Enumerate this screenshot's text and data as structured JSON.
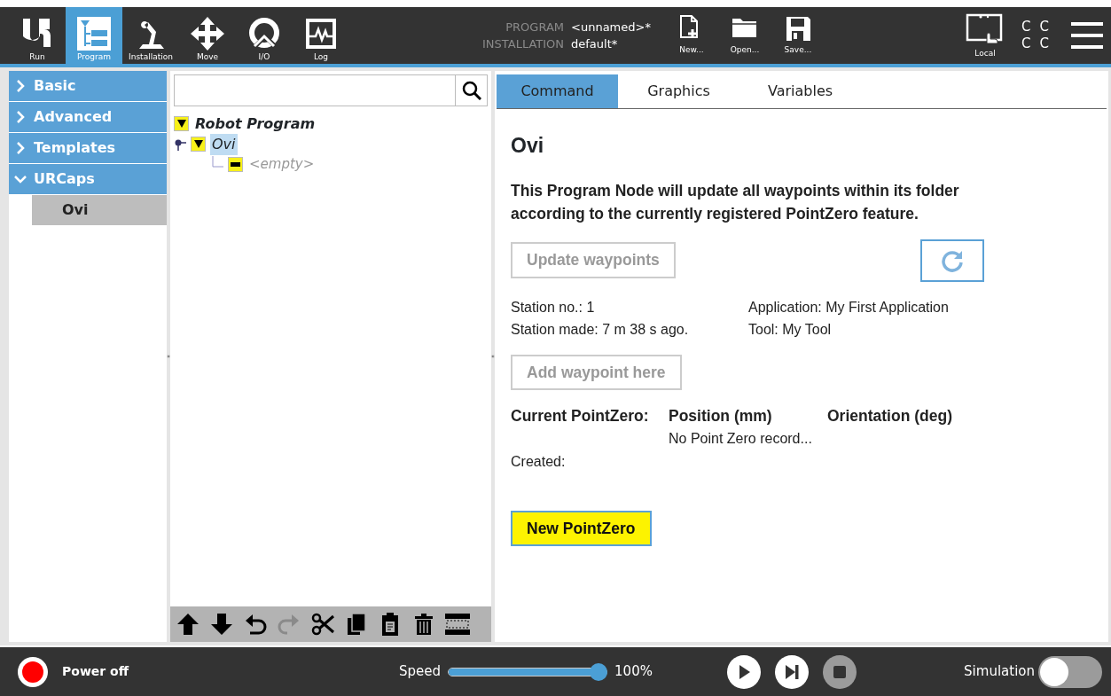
{
  "header": {
    "nav": [
      {
        "label": "Run",
        "kind": "logo",
        "selected": false
      },
      {
        "label": "Program",
        "kind": "program",
        "selected": true
      },
      {
        "label": "Installation",
        "kind": "arm",
        "selected": false
      },
      {
        "label": "Move",
        "kind": "move",
        "selected": false
      },
      {
        "label": "I/O",
        "kind": "io",
        "selected": false
      },
      {
        "label": "Log",
        "kind": "log",
        "selected": false
      }
    ],
    "program_label": "PROGRAM",
    "program_value": "<unnamed>*",
    "installation_label": "INSTALLATION",
    "installation_value": "default*",
    "file_buttons": [
      {
        "label": "New...",
        "kind": "new"
      },
      {
        "label": "Open...",
        "kind": "open"
      },
      {
        "label": "Save...",
        "kind": "save"
      }
    ],
    "mode": "Local",
    "status_letters": [
      "C",
      "C",
      "C",
      "C"
    ]
  },
  "sidebar": [
    {
      "label": "Basic",
      "expanded": false
    },
    {
      "label": "Advanced",
      "expanded": false
    },
    {
      "label": "Templates",
      "expanded": false
    },
    {
      "label": "URCaps",
      "expanded": true,
      "children": [
        {
          "label": "Ovi",
          "selected": true
        }
      ]
    }
  ],
  "tree": [
    {
      "label": "Robot Program",
      "kind": "root",
      "expanded": true,
      "selected": false,
      "children": [
        {
          "label": "Ovi",
          "kind": "node",
          "expanded": true,
          "selected": true,
          "children": [
            {
              "label": "<empty>",
              "kind": "empty"
            }
          ]
        }
      ]
    }
  ],
  "tree_toolbar": [
    {
      "kind": "up",
      "disabled": false
    },
    {
      "kind": "down",
      "disabled": false
    },
    {
      "kind": "undo",
      "disabled": false
    },
    {
      "kind": "redo",
      "disabled": true
    },
    {
      "kind": "cut",
      "disabled": false
    },
    {
      "kind": "copy",
      "disabled": false
    },
    {
      "kind": "paste",
      "disabled": false
    },
    {
      "kind": "delete",
      "disabled": false
    },
    {
      "kind": "suppress",
      "disabled": false
    }
  ],
  "tabs": [
    {
      "label": "Command",
      "selected": true
    },
    {
      "label": "Graphics",
      "selected": false
    },
    {
      "label": "Variables",
      "selected": false
    }
  ],
  "node": {
    "title": "Ovi",
    "description": "This Program Node will update all waypoints within its folder according to the currently registered PointZero feature.",
    "update_button": {
      "label": "Update waypoints",
      "disabled": true
    },
    "station_no": "Station no.: 1",
    "station_made": "Station made: 7 m 38 s ago.",
    "application": "Application: My First Application",
    "tool": "Tool: My Tool",
    "add_button": {
      "label": "Add waypoint here",
      "disabled": true
    },
    "columns": [
      "Current PointZero:",
      "Position (mm)",
      "Orientation (deg)"
    ],
    "position_value": "No Point Zero record...",
    "created_label": "Created:",
    "new_button": {
      "label": "New PointZero",
      "disabled": false
    }
  },
  "footer": {
    "power": "Power off",
    "speed_label": "Speed",
    "speed": {
      "level": 1.0,
      "reading": "100%"
    },
    "controls": [
      {
        "kind": "play",
        "disabled": false
      },
      {
        "kind": "step",
        "disabled": false
      },
      {
        "kind": "stop",
        "disabled": true
      }
    ],
    "simulation_label": "Simulation",
    "simulation_on": false
  }
}
